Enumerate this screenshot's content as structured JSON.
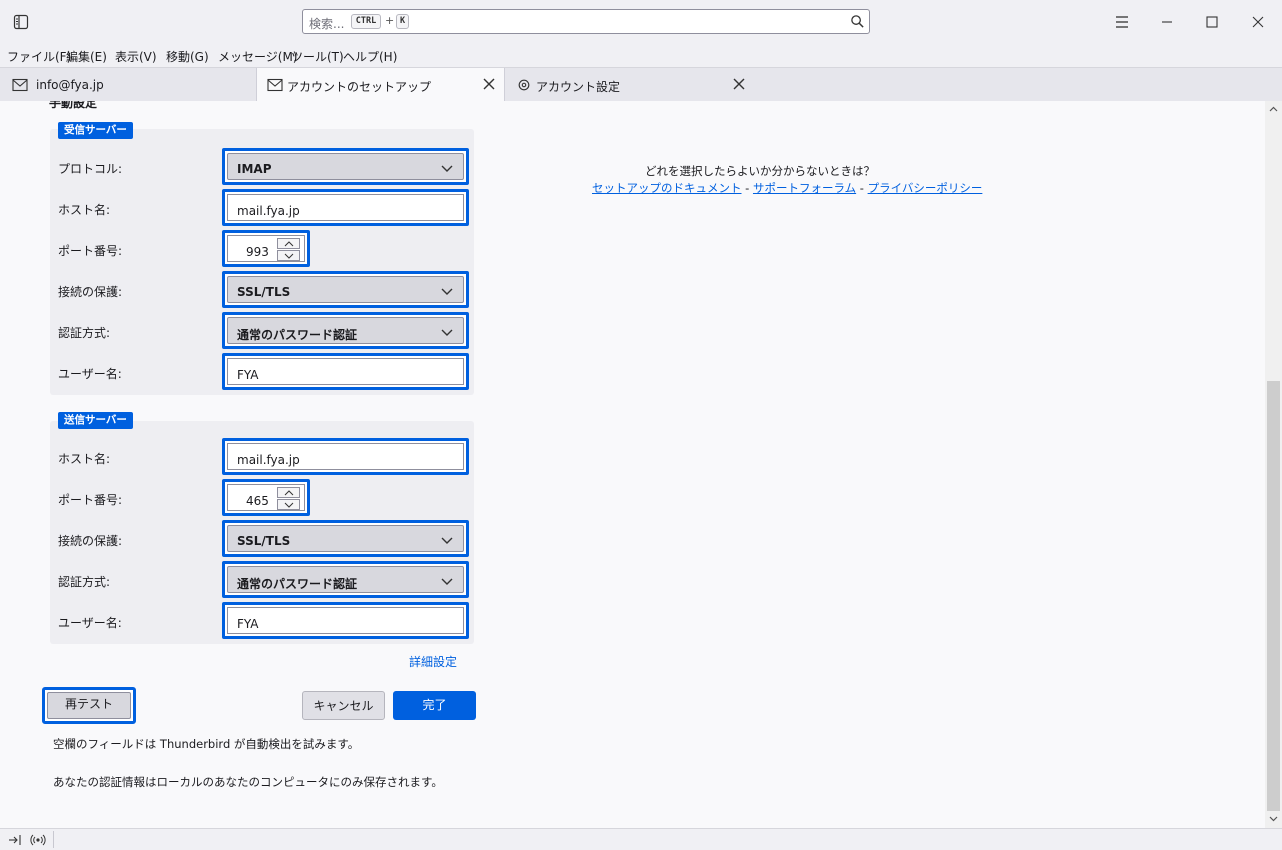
{
  "titlebar": {
    "search_placeholder": "検索...",
    "shortcut_key1": "CTRL",
    "shortcut_plus": "+",
    "shortcut_key2": "K"
  },
  "menu": [
    "ファイル(F)",
    "編集(E)",
    "表示(V)",
    "移動(G)",
    "メッセージ(M)",
    "ツール(T)",
    "ヘルプ(H)"
  ],
  "tabs": [
    {
      "label": "info@fya.jp"
    },
    {
      "label": "アカウントのセットアップ"
    },
    {
      "label": "アカウント設定"
    }
  ],
  "form": {
    "section_title": "手動設定",
    "incoming": {
      "badge": "受信サーバー",
      "protocol_label": "プロトコル:",
      "protocol_value": "IMAP",
      "host_label": "ホスト名:",
      "host_value": "mail.fya.jp",
      "port_label": "ポート番号:",
      "port_value": "993",
      "security_label": "接続の保護:",
      "security_value": "SSL/TLS",
      "auth_label": "認証方式:",
      "auth_value": "通常のパスワード認証",
      "user_label": "ユーザー名:",
      "user_value": "FYA"
    },
    "outgoing": {
      "badge": "送信サーバー",
      "host_label": "ホスト名:",
      "host_value": "mail.fya.jp",
      "port_label": "ポート番号:",
      "port_value": "465",
      "security_label": "接続の保護:",
      "security_value": "SSL/TLS",
      "auth_label": "認証方式:",
      "auth_value": "通常のパスワード認証",
      "user_label": "ユーザー名:",
      "user_value": "FYA"
    },
    "advanced_link": "詳細設定",
    "retest_label": "再テスト",
    "cancel_label": "キャンセル",
    "done_label": "完了",
    "note1": "空欄のフィールドは Thunderbird が自動検出を試みます。",
    "note2": "あなたの認証情報はローカルのあなたのコンピュータにのみ保存されます。"
  },
  "help": {
    "question": "どれを選択したらよいか分からないときは？",
    "link_docs": "セットアップのドキュメント",
    "sep1": " - ",
    "link_forum": "サポートフォーラム",
    "sep2": " - ",
    "link_privacy": "プライバシーポリシー"
  },
  "colors": {
    "accent": "#0060df",
    "focus_ring": "#0060df",
    "background": "#f9f9fb"
  }
}
